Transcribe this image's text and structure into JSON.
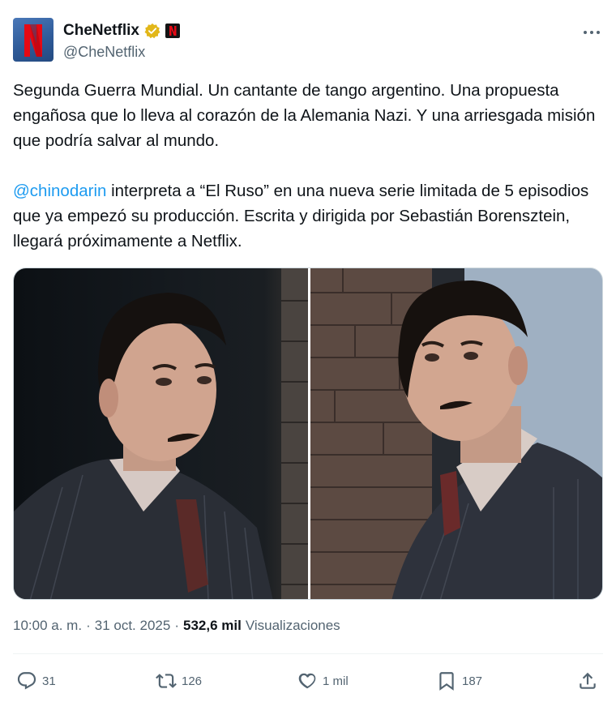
{
  "account": {
    "display_name": "CheNetflix",
    "handle": "@CheNetflix",
    "avatar_letter": "N"
  },
  "tweet": {
    "paragraph1": "Segunda Guerra Mundial. Un cantante de tango argentino. Una propuesta engañosa que lo lleva al corazón de la Alemania Nazi. Y una arriesgada misión que podría salvar al mundo.",
    "mention": "@chinodarin",
    "paragraph2_rest": " interpreta a “El Ruso” en una nueva serie limitada de 5 episodios que ya empezó su producción. Escrita y dirigida por Sebastián Borensztein, llegará próximamente a Netflix."
  },
  "meta": {
    "time": "10:00 a. m.",
    "separator": "·",
    "date": "31 oct. 2025",
    "views_count": "532,6 mil",
    "views_label": "Visualizaciones"
  },
  "actions": {
    "replies": "31",
    "reposts": "126",
    "likes": "1 mil",
    "bookmarks": "187"
  },
  "colors": {
    "accent": "#1d9bf0",
    "netflix_red": "#e50914",
    "verified_gold": "#e2b719",
    "muted": "#536471"
  },
  "icons": [
    "verified-icon",
    "netflix-badge-icon",
    "more-icon",
    "reply-icon",
    "repost-icon",
    "like-icon",
    "bookmark-icon",
    "share-icon"
  ]
}
